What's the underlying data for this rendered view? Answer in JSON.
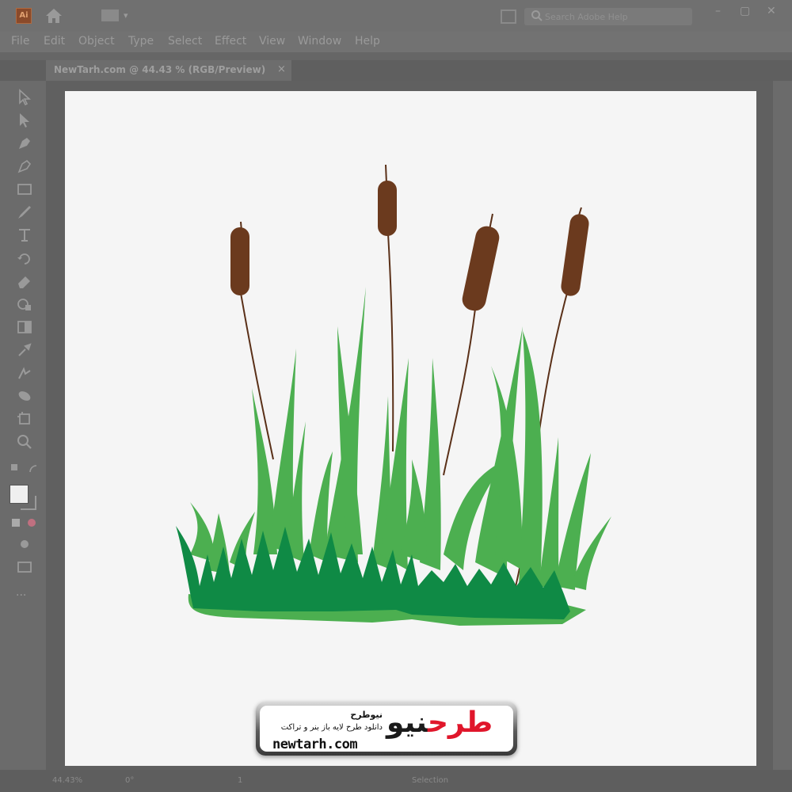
{
  "app": {
    "logo_text": "Ai"
  },
  "search": {
    "placeholder": "Search Adobe Help"
  },
  "menu": [
    "File",
    "Edit",
    "Object",
    "Type",
    "Select",
    "Effect",
    "View",
    "Window",
    "Help"
  ],
  "document_tab": {
    "label": "NewTarh.com @ 44.43 % (RGB/Preview)",
    "close": "×"
  },
  "window_controls": {
    "minimize": "–",
    "maximize": "▢",
    "close": "✕"
  },
  "statusbar": {
    "zoom": "44.43%",
    "rotation": "0°",
    "artboard": "1",
    "mode": "Selection"
  },
  "badge": {
    "brand": "نیوطرح",
    "tagline": "دانلود طرح لایه باز بنر و تراکت",
    "url": "newtarh.com",
    "logo": "نیو",
    "logo2": "طرح"
  },
  "colors": {
    "chrome": "#707070",
    "canvas": "#f5f5f5",
    "grass_light": "#4caf50",
    "grass_dark": "#0f8a45",
    "cattail": "#6b3a1e",
    "stem": "#5a3018"
  },
  "artwork": {
    "subject": "cattails-and-grass-illustration"
  }
}
